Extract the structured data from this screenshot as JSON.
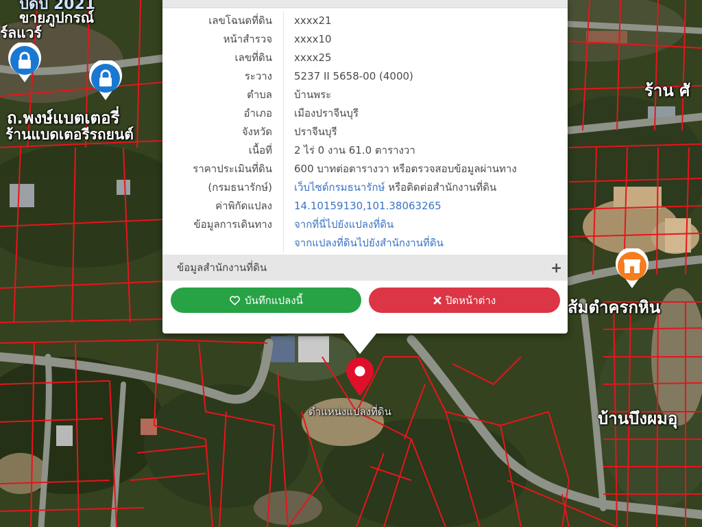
{
  "map": {
    "labels": {
      "top_left_1": "ขายภูปกรณ์",
      "top_left_2": "ร์ลแวร์",
      "battery_1": "ถ.พงษ์แบตเตอรี่",
      "battery_2": "ร้านแบดเตอรีรถยนต์",
      "top_right": "ร้าน ศั",
      "right_mid": "ส้มตำครกหิน",
      "right_bottom": "บ้านบึงผมอุ",
      "marker_caption": "ตำแหน่งแปลงที่ดิน",
      "top_fragment": "ปิดปี 2021"
    },
    "colors": {
      "parcel_lines": "#e8141c",
      "marker": "#e0102b",
      "poi_blue": "#1a78d3",
      "poi_orange": "#f57c1f"
    },
    "icons": [
      "lock-icon",
      "lock-icon",
      "shop-icon",
      "map-marker-icon"
    ]
  },
  "popup": {
    "rows": [
      {
        "label": "เลขโฉนดที่ดิน",
        "value": "xxxx21"
      },
      {
        "label": "หน้าสำรวจ",
        "value": "xxxx10"
      },
      {
        "label": "เลขที่ดิน",
        "value": "xxxx25"
      },
      {
        "label": "ระวาง",
        "value": "5237 II 5658-00 (4000)"
      },
      {
        "label": "ตำบล",
        "value": "บ้านพระ"
      },
      {
        "label": "อำเภอ",
        "value": "เมืองปราจีนบุรี"
      },
      {
        "label": "จังหวัด",
        "value": "ปราจีนบุรี"
      },
      {
        "label": "เนื้อที่",
        "value": "2 ไร่ 0 งาน 61.0 ตารางวา"
      },
      {
        "label": "ราคาประเมินที่ดิน",
        "value": "600 บาทต่อตารางวา หรือตรวจสอบข้อมูลผ่านทาง"
      },
      {
        "label": "(กรมธนารักษ์)",
        "link": "เว็บไซต์กรมธนารักษ์",
        "value": " หรือติดต่อสำนักงานที่ดิน"
      },
      {
        "label": "ค่าพิกัดแปลง",
        "link": "14.10159130,101.38063265"
      },
      {
        "label": "ข้อมูลการเดินทาง",
        "link": "จากที่นี่ไปยังแปลงที่ดิน"
      },
      {
        "label": "",
        "link": "จากแปลงที่ดินไปยังสำนักงานที่ดิน"
      }
    ],
    "office_section": {
      "title": "ข้อมูลสำนักงานที่ดิน",
      "expand": "+"
    },
    "buttons": {
      "save": "บันทึกแปลงนี้",
      "close": "ปิดหน้าต่าง"
    },
    "colors": {
      "save": "#27a245",
      "close": "#dc3545",
      "link": "#3a73c6"
    }
  }
}
